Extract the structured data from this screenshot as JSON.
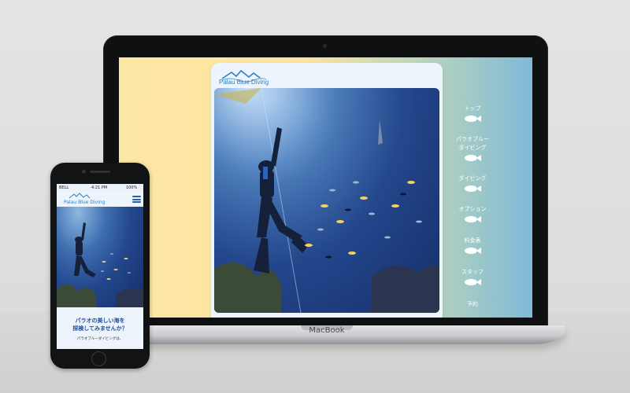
{
  "laptop": {
    "brand_label": "MacBook"
  },
  "site": {
    "logo_text": "Palau Blue Diving",
    "nav": [
      {
        "label_lines": [
          "トップ"
        ]
      },
      {
        "label_lines": [
          "パラオブルー",
          "ダイビング"
        ]
      },
      {
        "label_lines": [
          "ダイビング"
        ]
      },
      {
        "label_lines": [
          "オプション"
        ]
      },
      {
        "label_lines": [
          "料金表"
        ]
      },
      {
        "label_lines": [
          "スタッフ"
        ]
      },
      {
        "label_lines": [
          "予約"
        ]
      }
    ],
    "headline_line1": "パラオの美しい海を",
    "headline_line2": "探検してみませんか？",
    "intro_text": "パラオブルーダイビングは、"
  },
  "phone_status": {
    "carrier": "BELL",
    "time": "4:21 PM",
    "battery": "100%"
  },
  "colors": {
    "brand_blue": "#2d7fc2",
    "heading_blue": "#1f4f9c",
    "bg_yellow": "#fde7a5",
    "bg_blue": "#7fbad7"
  }
}
